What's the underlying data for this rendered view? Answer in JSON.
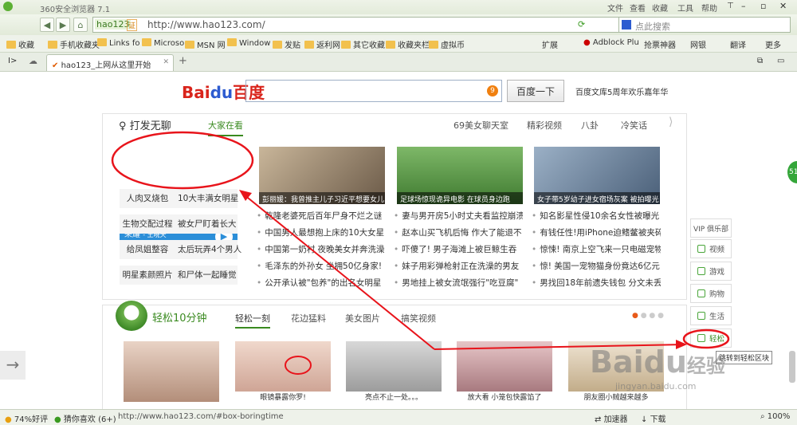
{
  "window": {
    "title": "360安全浏览器 7.1",
    "menu": [
      "文件",
      "查看",
      "收藏",
      "工具",
      "帮助"
    ]
  },
  "nav": {
    "site_badge": "hao123",
    "cert": "证",
    "url": "http://www.hao123.com/",
    "search_placeholder": "点此搜索"
  },
  "favorites": {
    "items": [
      "收藏",
      "手机收藏夹",
      "Links fo",
      "Microso",
      "MSN 网",
      "Window",
      "发贴",
      "返利网",
      "其它收藏",
      "收藏夹栏",
      "虚拟币"
    ],
    "right": [
      "扩展",
      "Adblock Plu",
      "抢票神器",
      "网银",
      "翻译",
      "更多"
    ]
  },
  "tabs": [
    {
      "label": "hao123_上网从这里开始"
    }
  ],
  "baidu": {
    "logo_left": "Bai",
    "logo_mid": "du",
    "logo_right": "百度",
    "badge": "9",
    "button": "百度一下",
    "promo": "百度文库5周年欢乐嘉年华"
  },
  "panel": {
    "title": "打发无聊",
    "tabs": [
      "大家在看",
      "69美女聊天室",
      "精彩视频",
      "八卦",
      "冷笑话"
    ],
    "player": {
      "song": "荣耀",
      "artist": "- 王晓天"
    },
    "tags": [
      "人肉叉烧包",
      "10大丰满女明星",
      "生物交配过程",
      "被女尸盯着长大",
      "给凤姐整容",
      "太后玩弄4个男人",
      "明星素颜照片",
      "和尸体一起睡觉"
    ],
    "pics": [
      "彭丽媛：我曾推主儿子习近平想要女儿",
      "足球场惊现诡异电影 在球员身边跑",
      "女子带5岁幼子进女宿场灰案 被拍曝光"
    ],
    "news_col1": [
      "乾隆老婆死后百年尸身不烂之谜",
      "中国男人最想抱上床的10大女星",
      "中国第一奶村 夜晚美女并奔洗澡",
      "毛泽东的外孙女 坐拥50亿身家!",
      "公开承认被\"包养\"的出名女明星"
    ],
    "news_col2": [
      "妻与男开房5小时丈夫看监控崩溃",
      "赵本山买飞机后悔 作大了能退不",
      "吓傻了! 男子海滩上被巨鲸生吞",
      "妹子用彩弹枪射正在洗澡的男友",
      "男地挂上被女流氓强行\"吃豆腐\""
    ],
    "news_col3": [
      "知名影星性侵10余名女性被曝光",
      "有钱任性!用iPhone迫鳍鳖被夹碎",
      "惊悚! 南京上空飞来一只电磁宠物",
      "惊! 美国一宠物猫身份竟达6亿元",
      "男找回18年前遗失钱包 分文未丢"
    ]
  },
  "panel2": {
    "title": "轻松10分钟",
    "tabs": [
      "轻松一刻",
      "花边猛料",
      "美女图片",
      "搞笑视频"
    ],
    "thumbs": [
      "",
      "眼镜暴露你罗!",
      "亮点不止一处。。。",
      "放大看 小笼包快露馅了",
      "朋友圈小贼越来越多"
    ]
  },
  "sidebar": {
    "header": "VIP 俱乐部",
    "items": [
      "视频",
      "游戏",
      "购物",
      "生活",
      "轻松"
    ],
    "tooltip": "跳转到轻松区块"
  },
  "status": {
    "rating": "74%好评",
    "guess": "猜你喜欢 (6+)",
    "link": "http://www.hao123.com/#box-boringtime",
    "accel": "加速器",
    "download": "下载",
    "zoom": "100%"
  },
  "watermark": {
    "brand": "Baidu",
    "sub": "经验",
    "url": "jingyan.baidu.com"
  },
  "annotation": {
    "color": "#e8141b"
  }
}
